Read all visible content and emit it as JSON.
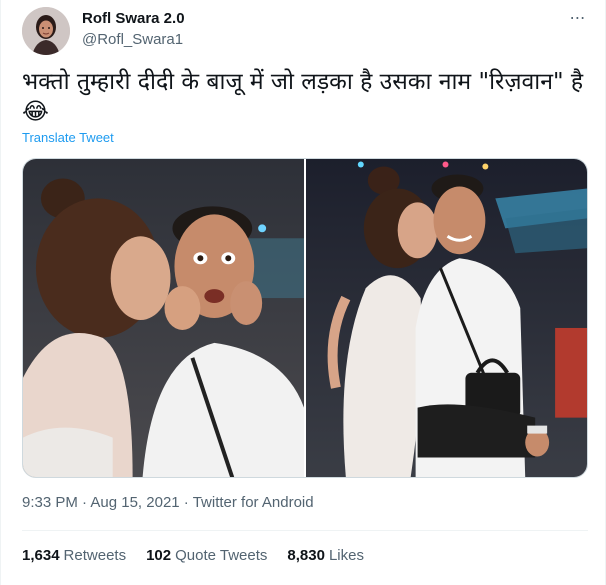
{
  "author": {
    "name": "Rofl Swara 2.0",
    "handle": "@Rofl_Swara1",
    "avatar_icon": "profile-avatar"
  },
  "more_icon": "⋯",
  "tweet": {
    "text": "भक्तो तुम्हारी दीदी के बाजू में जो लड़का है उसका नाम \"रिज़वान\" है😂",
    "translate_label": "Translate Tweet"
  },
  "media": {
    "count": 2,
    "photos": [
      "photo-kiss-cheek-closeup",
      "photo-kiss-standing"
    ]
  },
  "meta": {
    "time": "9:33 PM",
    "sep1": " · ",
    "date": "Aug 15, 2021",
    "sep2": " · ",
    "source": "Twitter for Android"
  },
  "stats": {
    "retweets_count": "1,634",
    "retweets_label": "Retweets",
    "quotes_count": "102",
    "quotes_label": "Quote Tweets",
    "likes_count": "8,830",
    "likes_label": "Likes"
  },
  "colors": {
    "link": "#1d9bf0",
    "secondary_text": "#536471",
    "primary_text": "#0f1419",
    "border": "#cfd9de"
  }
}
